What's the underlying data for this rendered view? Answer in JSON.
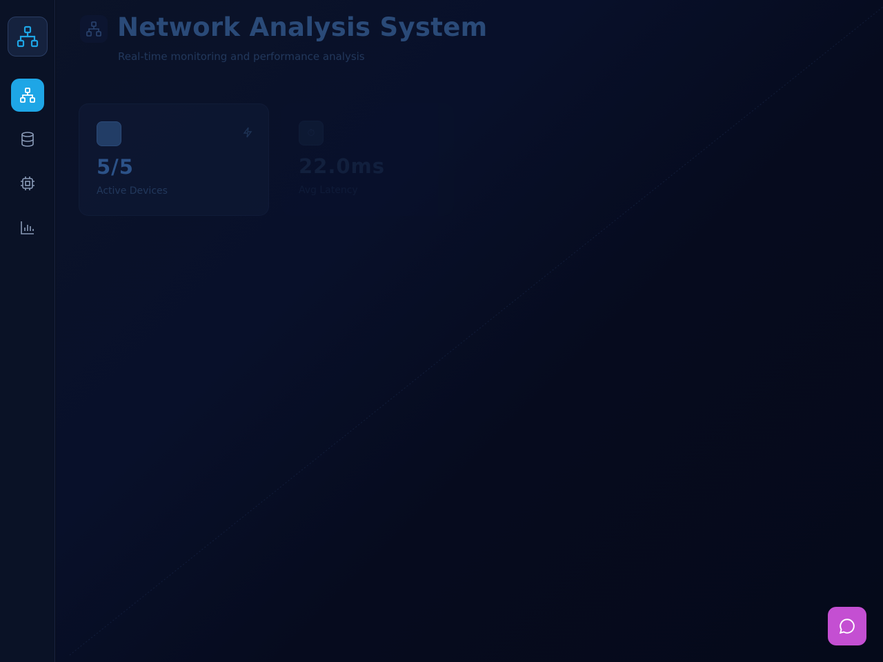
{
  "app": {
    "title": "Network Analysis System",
    "subtitle": "Real-time monitoring and performance analysis"
  },
  "sidebar": {
    "logo_icon": "network-icon",
    "items": [
      {
        "icon": "network-icon",
        "active": true
      },
      {
        "icon": "database-icon",
        "active": false
      },
      {
        "icon": "cpu-icon",
        "active": false
      },
      {
        "icon": "bar-chart-icon",
        "active": false
      }
    ]
  },
  "stats": [
    {
      "value": "5/5",
      "label": "Active Devices",
      "icon": "bolt-icon"
    },
    {
      "value": "22.0ms",
      "label": "Avg Latency",
      "icon": "clock-icon"
    }
  ],
  "chat": {
    "icon": "chat-bubble-icon",
    "color": "#c44fd2"
  },
  "colors": {
    "accent": "#1ea6e6",
    "background": "#070c1c",
    "sidebar": "#0a1226"
  }
}
